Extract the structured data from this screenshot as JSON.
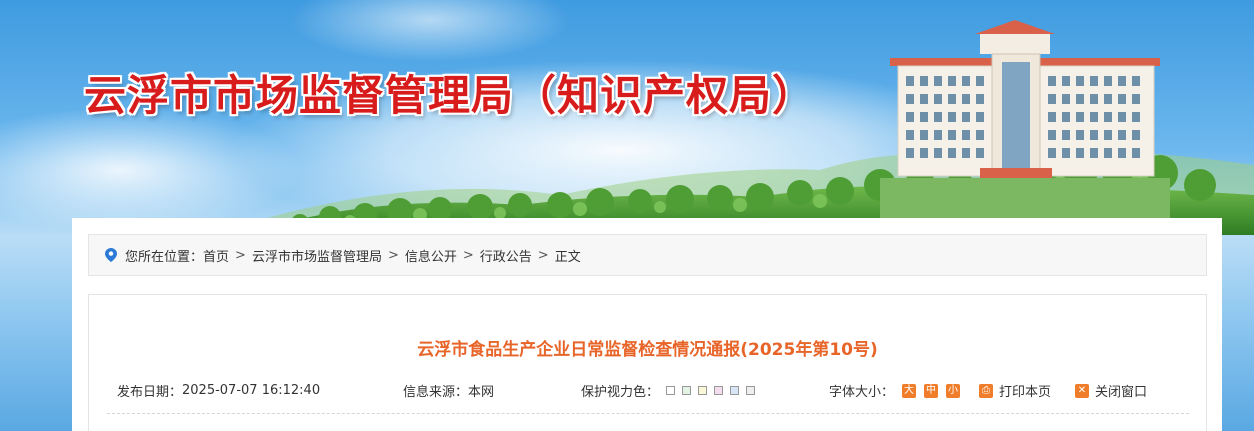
{
  "header": {
    "site_title": "云浮市市场监督管理局（知识产权局）"
  },
  "breadcrumb": {
    "prefix": "您所在位置：",
    "items": [
      "首页",
      "云浮市市场监督管理局",
      "信息公开",
      "行政公告",
      "正文"
    ],
    "separator": ">"
  },
  "article": {
    "title": "云浮市食品生产企业日常监督检查情况通报(2025年第10号)",
    "publish_label": "发布日期：",
    "publish_date": "2025-07-07 16:12:40",
    "source_label": "信息来源：",
    "source": "本网",
    "protect_label": "保护视力色：",
    "protect_colors": [
      "#ffffff",
      "#e3f3e3",
      "#faf7d6",
      "#f5ddf0",
      "#d7e5f7",
      "#eeeeee"
    ],
    "fontsize_label": "字体大小：",
    "fontsize_options": [
      "大",
      "中",
      "小"
    ],
    "print_label": "打印本页",
    "close_label": "关闭窗口"
  },
  "colors": {
    "title_red": "#d81c1c",
    "article_title_orange": "#e8652a",
    "accent_orange": "#ef7d2a",
    "location_pin_blue": "#2b7bd6"
  }
}
